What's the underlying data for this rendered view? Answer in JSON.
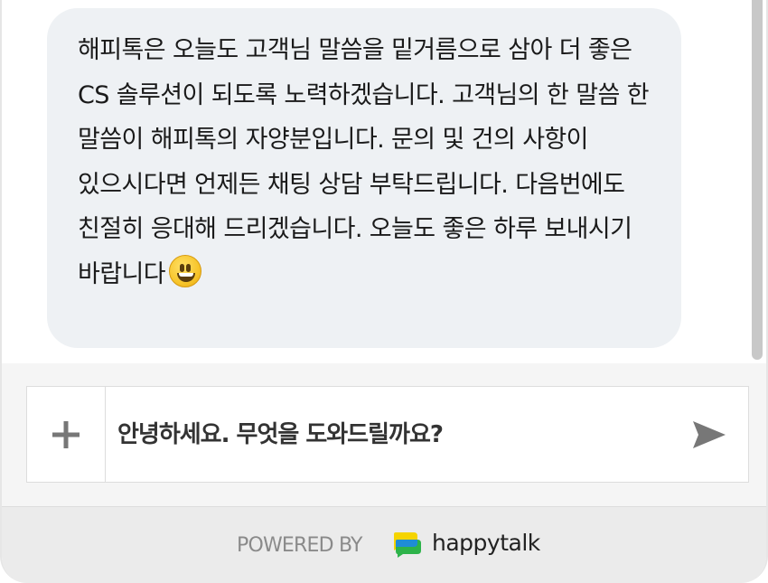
{
  "chat": {
    "message_text": "해피톡은 오늘도 고객님 말씀을 밑거름으로 삼아 더 좋은 CS 솔루션이 되도록 노력하겠습니다. 고객님의 한 말씀 한 말씀이 해피톡의 자양분입니다. 문의 및 건의 사항이 있으시다면 언제든 채팅 상담 부탁드립니다. 다음번에도 친절히 응대해 드리겠습니다. 오늘도 좋은 하루 보내시기 바랍니다",
    "emoji_icon": "grinning-face-icon"
  },
  "composer": {
    "attach_icon": "plus-icon",
    "placeholder": "안녕하세요. 무엇을 도와드릴까요?",
    "value": "",
    "send_icon": "send-icon"
  },
  "footer": {
    "powered_by": "POWERED BY",
    "brand_icon": "happytalk-logo",
    "brand_name": "happytalk"
  },
  "colors": {
    "bubble_bg": "#eef1f4",
    "footer_bg": "#ebebeb",
    "input_strip_bg": "#f5f5f5",
    "icon_gray": "#777777",
    "logo_yellow": "#f5d400",
    "logo_green": "#2db34a",
    "logo_blue": "#1e88e5"
  }
}
